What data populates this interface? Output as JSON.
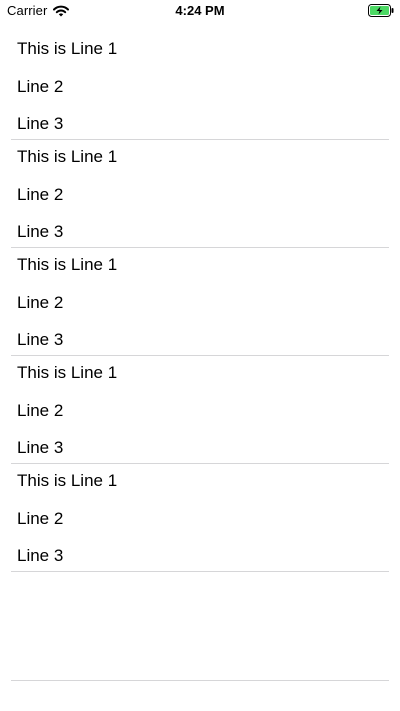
{
  "status_bar": {
    "carrier": "Carrier",
    "time": "4:24 PM",
    "wifi_icon": "wifi-icon",
    "battery_icon": "battery-charging-icon",
    "battery_color": "#4cd964"
  },
  "list": {
    "cells": [
      {
        "line1": "This is Line 1",
        "line2": "Line 2",
        "line3": "Line 3"
      },
      {
        "line1": "This is Line 1",
        "line2": "Line 2",
        "line3": "Line 3"
      },
      {
        "line1": "This is Line 1",
        "line2": "Line 2",
        "line3": "Line 3"
      },
      {
        "line1": "This is Line 1",
        "line2": "Line 2",
        "line3": "Line 3"
      },
      {
        "line1": "This is Line 1",
        "line2": "Line 2",
        "line3": "Line 3"
      }
    ]
  },
  "colors": {
    "background": "#ffffff",
    "text": "#000000",
    "separator": "#d6d6d8"
  }
}
